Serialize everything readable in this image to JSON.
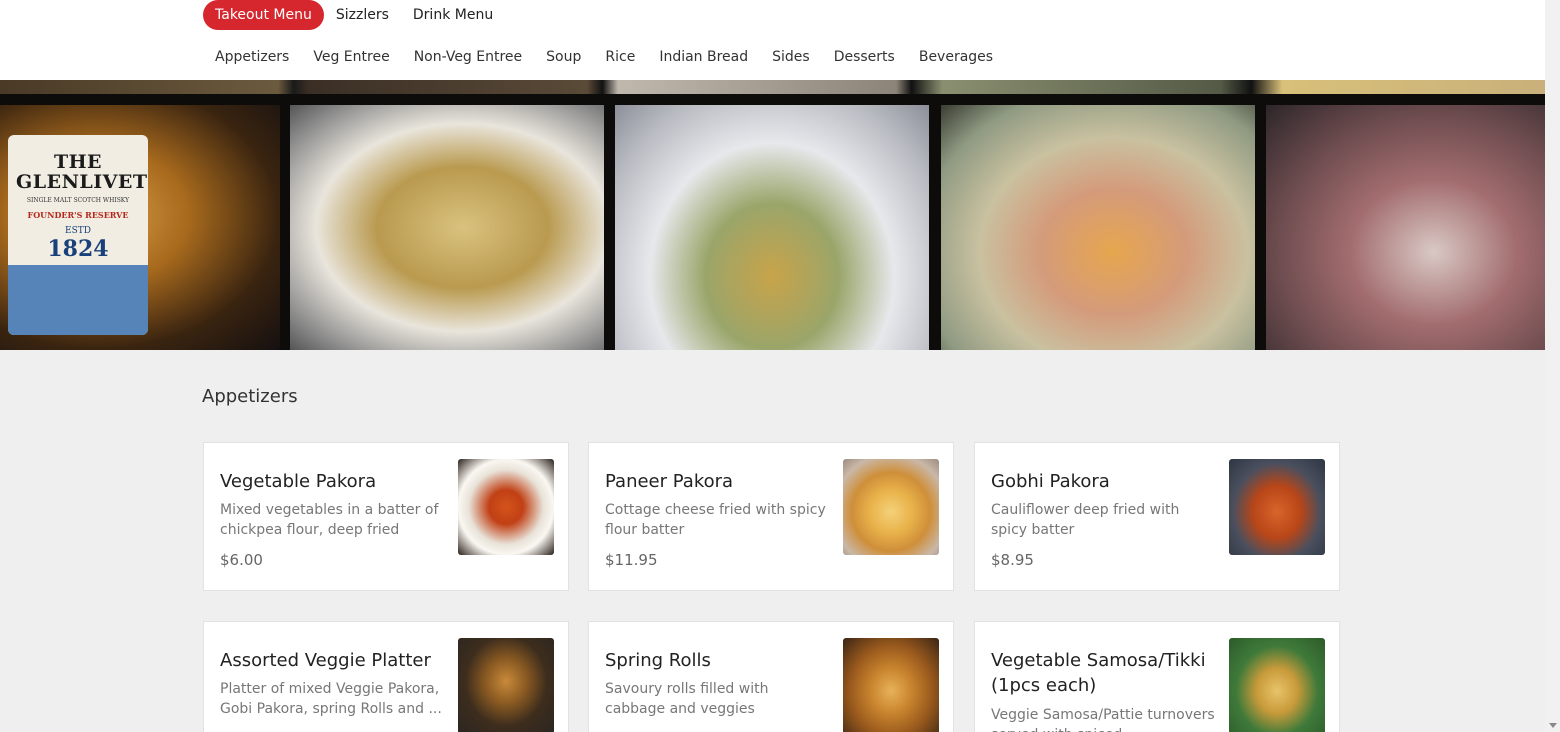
{
  "menu_tabs": [
    {
      "label": "Takeout Menu",
      "active": true
    },
    {
      "label": "Sizzlers",
      "active": false
    },
    {
      "label": "Drink Menu",
      "active": false
    }
  ],
  "categories": [
    "Appetizers",
    "Veg Entree",
    "Non-Veg Entree",
    "Soup",
    "Rice",
    "Indian Bread",
    "Sides",
    "Desserts",
    "Beverages"
  ],
  "hero": {
    "bottle_label": {
      "title_line1": "THE",
      "title_line2": "GLENLIVET",
      "subtitle": "SINGLE MALT SCOTCH WHISKY",
      "red_text": "FOUNDER'S RESERVE",
      "estd": "ESTD",
      "year": "1824"
    }
  },
  "section": {
    "title": "Appetizers",
    "items": [
      {
        "name": "Vegetable Pakora",
        "description": "Mixed vegetables in a batter of chickpea flour, deep fried",
        "price": "$6.00"
      },
      {
        "name": "Paneer Pakora",
        "description": "Cottage cheese fried with spicy flour batter",
        "price": "$11.95"
      },
      {
        "name": "Gobhi Pakora",
        "description": "Cauliflower deep fried with spicy batter",
        "price": "$8.95"
      },
      {
        "name": "Assorted Veggie Platter",
        "description": "Platter of mixed Veggie Pakora, Gobi Pakora, spring Rolls and ...",
        "price": ""
      },
      {
        "name": "Spring Rolls",
        "description": "Savoury rolls filled with cabbage and veggies",
        "price": ""
      },
      {
        "name": "Vegetable Samosa/Tikki (1pcs each)",
        "description": "Veggie Samosa/Pattie turnovers served with spiced",
        "price": ""
      }
    ]
  },
  "colors": {
    "accent": "#d6262e",
    "background": "#efefef"
  }
}
